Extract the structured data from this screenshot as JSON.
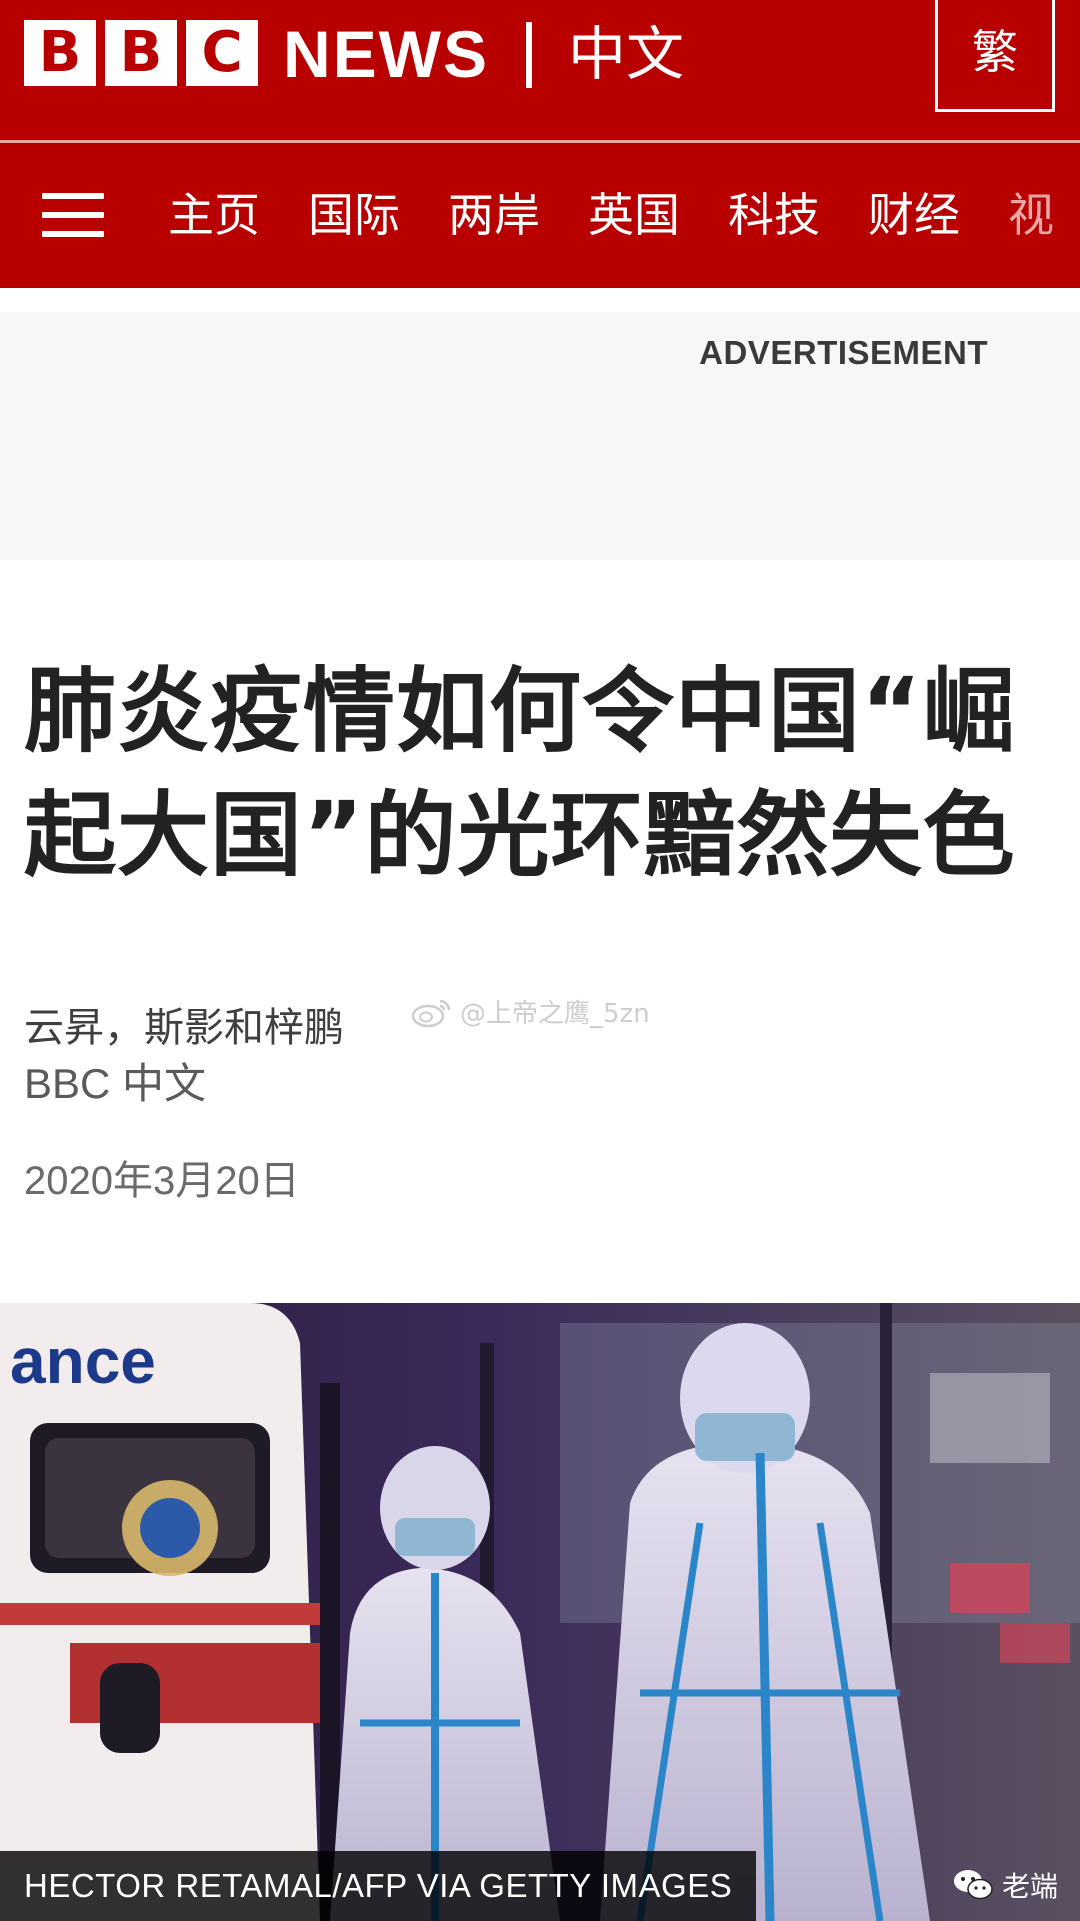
{
  "masthead": {
    "logo_letters": [
      "B",
      "B",
      "C"
    ],
    "news_word": "NEWS",
    "language": "中文",
    "script_toggle": "繁",
    "brand_color": "#b80000"
  },
  "nav": {
    "menu_icon": "hamburger-menu-icon",
    "items": [
      {
        "label": "主页"
      },
      {
        "label": "国际"
      },
      {
        "label": "两岸"
      },
      {
        "label": "英国"
      },
      {
        "label": "科技"
      },
      {
        "label": "财经"
      },
      {
        "label": "视"
      }
    ]
  },
  "ad": {
    "label": "ADVERTISEMENT"
  },
  "article": {
    "headline": "肺炎疫情如何令中国“崛起大国”的光环黯然失色",
    "authors": "云昇，斯影和梓鹏",
    "source": "BBC 中文",
    "date": "2020年3月20日"
  },
  "watermark": {
    "icon": "weibo-icon",
    "handle": "@上帝之鹰_5zn"
  },
  "photo": {
    "credit": "HECTOR RETAMAL/AFP VIA GETTY IMAGES",
    "ambulance_text": "ance",
    "wechat_icon": "wechat-icon",
    "wechat_label": "老端"
  }
}
